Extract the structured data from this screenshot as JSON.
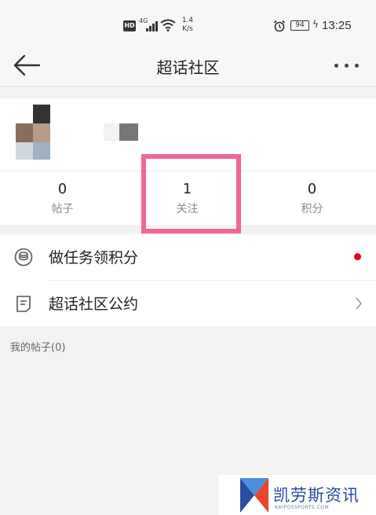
{
  "status_bar": {
    "hd_badge": "HD",
    "network_type": "4G",
    "net_speed_value": "1.4",
    "net_speed_unit": "K/s",
    "battery": "94",
    "time": "13:25"
  },
  "nav": {
    "title": "超话社区"
  },
  "stats": [
    {
      "value": "0",
      "label": "帖子"
    },
    {
      "value": "1",
      "label": "关注"
    },
    {
      "value": "0",
      "label": "积分"
    }
  ],
  "menu": {
    "tasks_label": "做任务领积分",
    "rules_label": "超话社区公约"
  },
  "posts_section": {
    "label": "我的帖子(0)"
  },
  "watermark": {
    "title": "凯劳斯资讯",
    "subtitle": "KAIPOSSPORTS.COM"
  },
  "colors": {
    "highlight_border": "#f0679a",
    "red_dot": "#e8001c",
    "watermark_blue": "#2a4da0"
  }
}
